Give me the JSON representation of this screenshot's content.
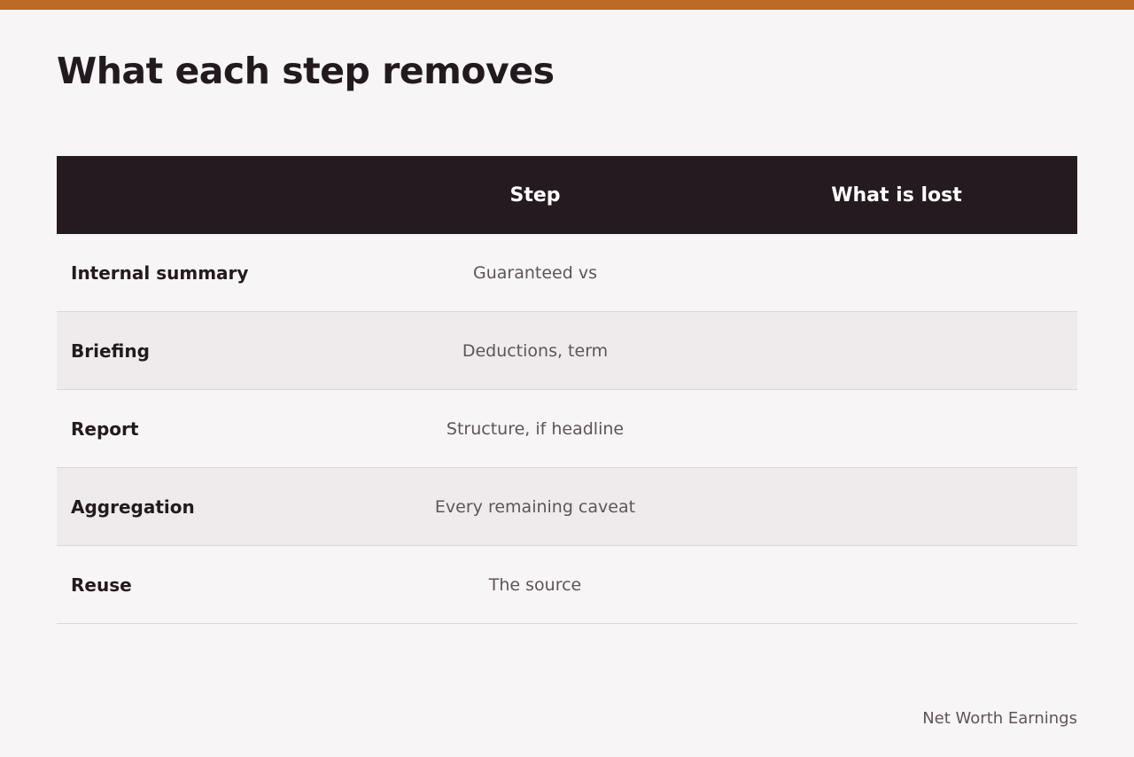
{
  "page": {
    "title": "What each step removes",
    "accent_color": "#bd6a26",
    "header_bg": "#251a1f"
  },
  "table": {
    "headers": [
      "",
      "Step",
      "What is lost"
    ],
    "rows": [
      {
        "label": "Internal summary",
        "step": "Guaranteed vs",
        "lost": ""
      },
      {
        "label": "Briefing",
        "step": "Deductions, term",
        "lost": ""
      },
      {
        "label": "Report",
        "step": "Structure, if headline",
        "lost": ""
      },
      {
        "label": "Aggregation",
        "step": "Every remaining caveat",
        "lost": ""
      },
      {
        "label": "Reuse",
        "step": "The source",
        "lost": ""
      }
    ]
  },
  "footer": {
    "brand": "Net Worth Earnings"
  }
}
